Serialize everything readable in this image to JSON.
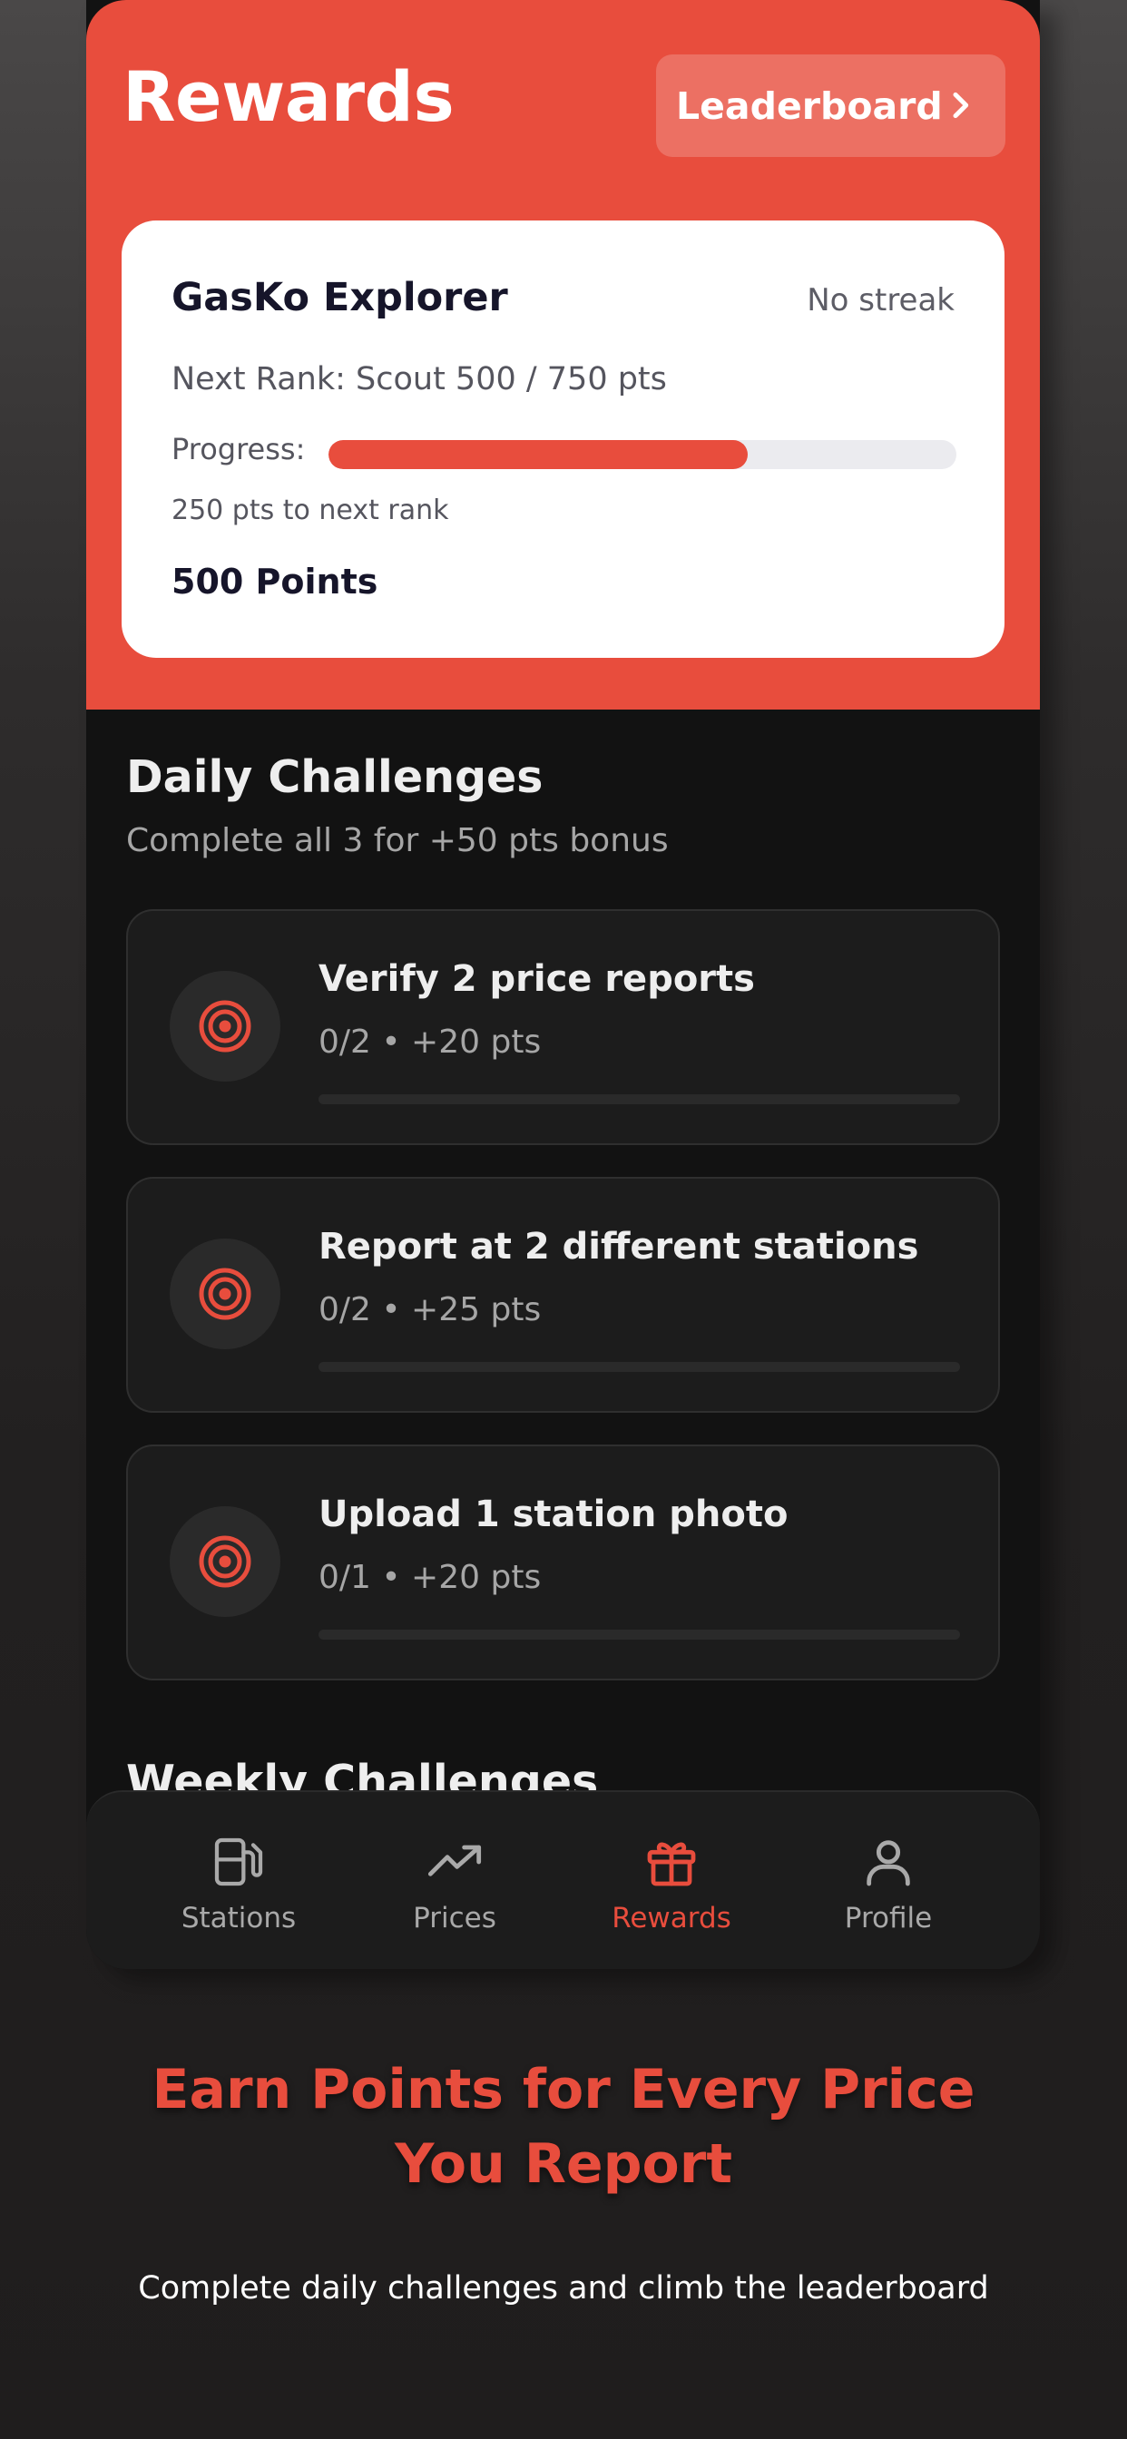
{
  "header": {
    "title": "Rewards",
    "leaderboard_label": "Leaderboard"
  },
  "rank_card": {
    "name": "GasKo Explorer",
    "streak": "No streak",
    "next_rank": "Next Rank: Scout 500 / 750 pts",
    "progress_label": "Progress:",
    "progress_fraction": 0.667,
    "remaining": "250 pts to next rank",
    "points": "500 Points"
  },
  "daily": {
    "title": "Daily Challenges",
    "subtitle": "Complete all 3 for +50 pts bonus",
    "items": [
      {
        "title": "Verify 2 price reports",
        "meta": "0/2 • +20 pts",
        "icon": "target-icon"
      },
      {
        "title": "Report at 2 different stations",
        "meta": "0/2 • +25 pts",
        "icon": "target-icon"
      },
      {
        "title": "Upload 1 station photo",
        "meta": "0/1 • +20 pts",
        "icon": "target-icon"
      }
    ]
  },
  "weekly": {
    "title": "Weekly Challenges"
  },
  "tabbar": {
    "items": [
      {
        "label": "Stations",
        "icon": "fuel-pump-icon",
        "active": false
      },
      {
        "label": "Prices",
        "icon": "trending-up-icon",
        "active": false
      },
      {
        "label": "Rewards",
        "icon": "gift-icon",
        "active": true
      },
      {
        "label": "Profile",
        "icon": "user-icon",
        "active": false
      }
    ]
  },
  "promo": {
    "title_line1": "Earn Points for Every Price",
    "title_line2": "You Report",
    "subtitle": "Complete daily challenges and climb the leaderboard"
  },
  "colors": {
    "accent": "#e84d3d",
    "background": "#121212",
    "card": "#1c1c1c"
  }
}
